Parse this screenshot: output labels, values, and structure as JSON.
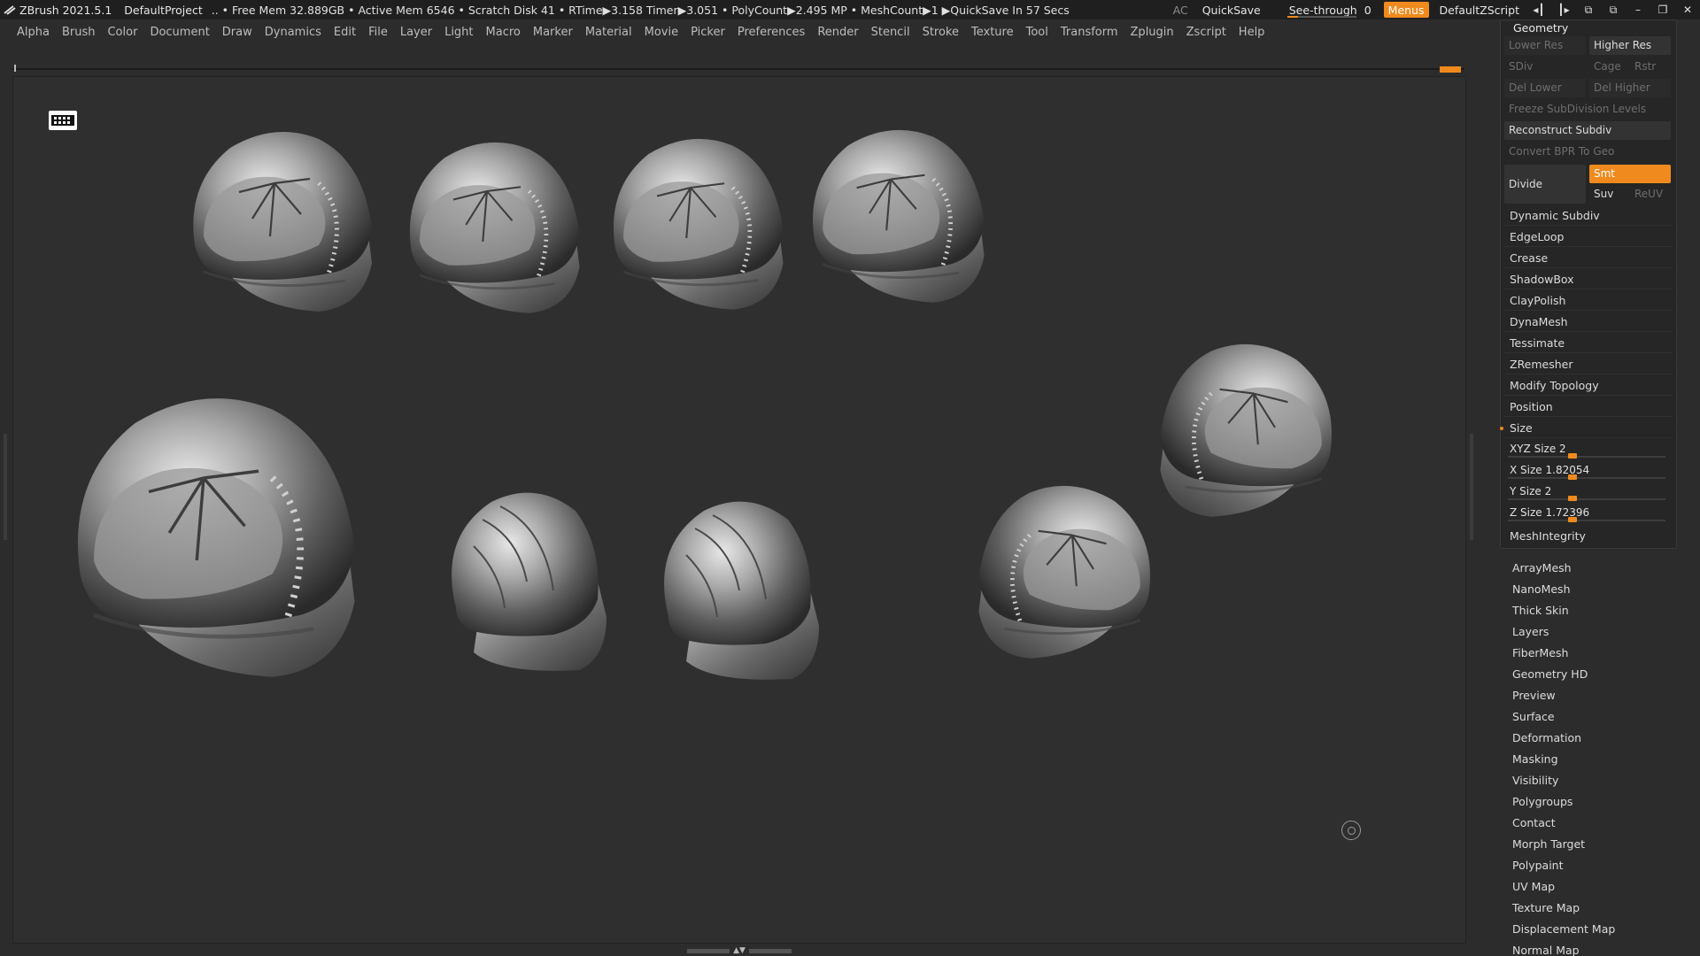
{
  "titlebar": {
    "app_name": "ZBrush 2021.5.1",
    "project": "DefaultProject",
    "stats": "..  • Free Mem 32.889GB • Active Mem 6546 • Scratch Disk 41 •  RTime▶3.158 Timer▶3.051 • PolyCount▶2.495 MP  • MeshCount▶1  ▶QuickSave In 57 Secs",
    "ac": "AC",
    "quicksave": "QuickSave",
    "seethrough_label": "See-through",
    "seethrough_value": "0",
    "menus": "Menus",
    "zscript": "DefaultZScript"
  },
  "menu": {
    "items": [
      "Alpha",
      "Brush",
      "Color",
      "Document",
      "Draw",
      "Dynamics",
      "Edit",
      "File",
      "Layer",
      "Light",
      "Macro",
      "Marker",
      "Material",
      "Movie",
      "Picker",
      "Preferences",
      "Render",
      "Stencil",
      "Stroke",
      "Texture",
      "Tool",
      "Transform",
      "Zplugin",
      "Zscript",
      "Help"
    ]
  },
  "panel": {
    "title": "Geometry",
    "lower_res": "Lower Res",
    "higher_res": "Higher Res",
    "sdiv": "SDiv",
    "cage": "Cage",
    "rstr": "Rstr",
    "del_lower": "Del Lower",
    "del_higher": "Del Higher",
    "freeze": "Freeze SubDivision Levels",
    "reconstruct": "Reconstruct Subdiv",
    "convert_bpr": "Convert BPR To Geo",
    "divide": "Divide",
    "smt": "Smt",
    "suv": "Suv",
    "reuv": "ReUV",
    "rows": [
      "Dynamic Subdiv",
      "EdgeLoop",
      "Crease",
      "ShadowBox",
      "ClayPolish",
      "DynaMesh",
      "Tessimate",
      "ZRemesher",
      "Modify Topology",
      "Position"
    ],
    "size_label": "Size",
    "sliders": [
      {
        "label": "XYZ Size",
        "value": "2",
        "level": 0.41
      },
      {
        "label": "X Size",
        "value": "1.82054",
        "level": 0.41
      },
      {
        "label": "Y Size",
        "value": "2",
        "level": 0.41
      },
      {
        "label": "Z Size",
        "value": "1.72396",
        "level": 0.41
      }
    ],
    "mesh_integrity": "MeshIntegrity"
  },
  "sublist": {
    "items": [
      "ArrayMesh",
      "NanoMesh",
      "Thick Skin",
      "Layers",
      "FiberMesh",
      "Geometry HD",
      "Preview",
      "Surface",
      "Deformation",
      "Masking",
      "Visibility",
      "Polygroups",
      "Contact",
      "Morph Target",
      "Polypaint",
      "UV Map",
      "Texture Map",
      "Displacement Map",
      "Normal Map"
    ]
  },
  "colors": {
    "accent": "#f08a1e",
    "background": "#2f2f2f",
    "panel": "#262626"
  }
}
